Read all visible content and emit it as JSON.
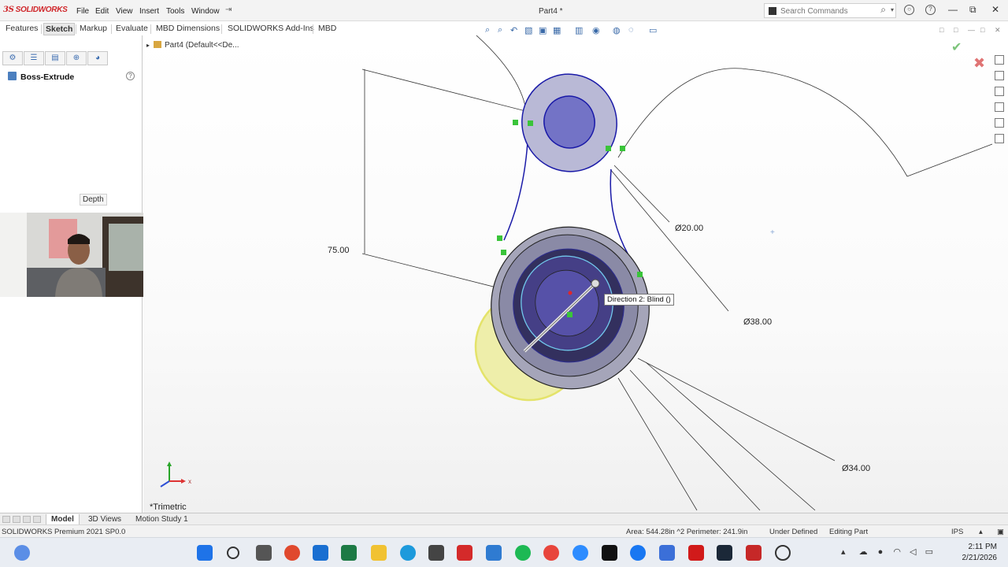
{
  "app": {
    "logo_text": "SOLIDWORKS",
    "title": "Part4 *",
    "menu": [
      "File",
      "Edit",
      "View",
      "Insert",
      "Tools",
      "Window"
    ]
  },
  "search": {
    "placeholder": "Search Commands"
  },
  "command_tabs": [
    {
      "label": "Features",
      "active": false
    },
    {
      "label": "Sketch",
      "active": true
    },
    {
      "label": "Markup",
      "active": false
    },
    {
      "label": "Evaluate",
      "active": false
    },
    {
      "label": "MBD Dimensions",
      "active": false
    },
    {
      "label": "SOLIDWORKS Add-Ins",
      "active": false
    },
    {
      "label": "MBD",
      "active": false
    }
  ],
  "property_manager": {
    "feature_name": "Boss-Extrude",
    "tooltip": "Depth"
  },
  "tree": {
    "root": "Part4 (Default<<De..."
  },
  "dimensions": {
    "d75": "75.00",
    "d20": "Ø20.00",
    "d38": "Ø38.00",
    "d34": "Ø34.00"
  },
  "callout": "Direction 2: Blind ()",
  "view_name": "*Trimetric",
  "bottom_tabs": [
    {
      "label": "Model",
      "active": true
    },
    {
      "label": "3D Views",
      "active": false
    },
    {
      "label": "Motion Study 1",
      "active": false
    }
  ],
  "status": {
    "left": "SOLIDWORKS Premium 2021 SP0.0",
    "measure": "Area: 544.28in ^2 Perimeter: 241.9in",
    "sketch_state": "Under Defined",
    "mode": "Editing Part",
    "units": "IPS"
  },
  "clock": {
    "time": "2:11 PM",
    "date": "2/21/2026"
  },
  "taskbar": {
    "apps": [
      "windows-start",
      "search",
      "task-view",
      "app-red",
      "outlook",
      "excel",
      "edge",
      "file-explorer",
      "ms-store",
      "app-l",
      "app-stylus",
      "spotify",
      "chrome",
      "zoom",
      "tiktok",
      "facebook",
      "app-blue",
      "netflix",
      "steam",
      "solidworks",
      "app-circle"
    ]
  },
  "colors": {
    "accent": "#3c6db0",
    "solidworks_red": "#d0262a",
    "sketch_blue": "#1a1aa8",
    "preview_yellow": "#e4e36a",
    "relation_green": "#3ac43a"
  }
}
